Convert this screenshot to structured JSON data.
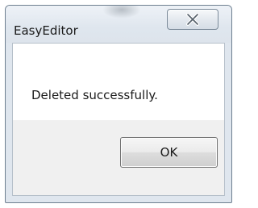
{
  "window": {
    "title": "EasyEditor"
  },
  "icons": {
    "close": "close-icon"
  },
  "dialog": {
    "message": "Deleted successfully.",
    "ok_label": "OK"
  },
  "colors": {
    "frame": "#dfe6ee",
    "client_bottom": "#f0f0f0",
    "message_bg": "#ffffff"
  }
}
